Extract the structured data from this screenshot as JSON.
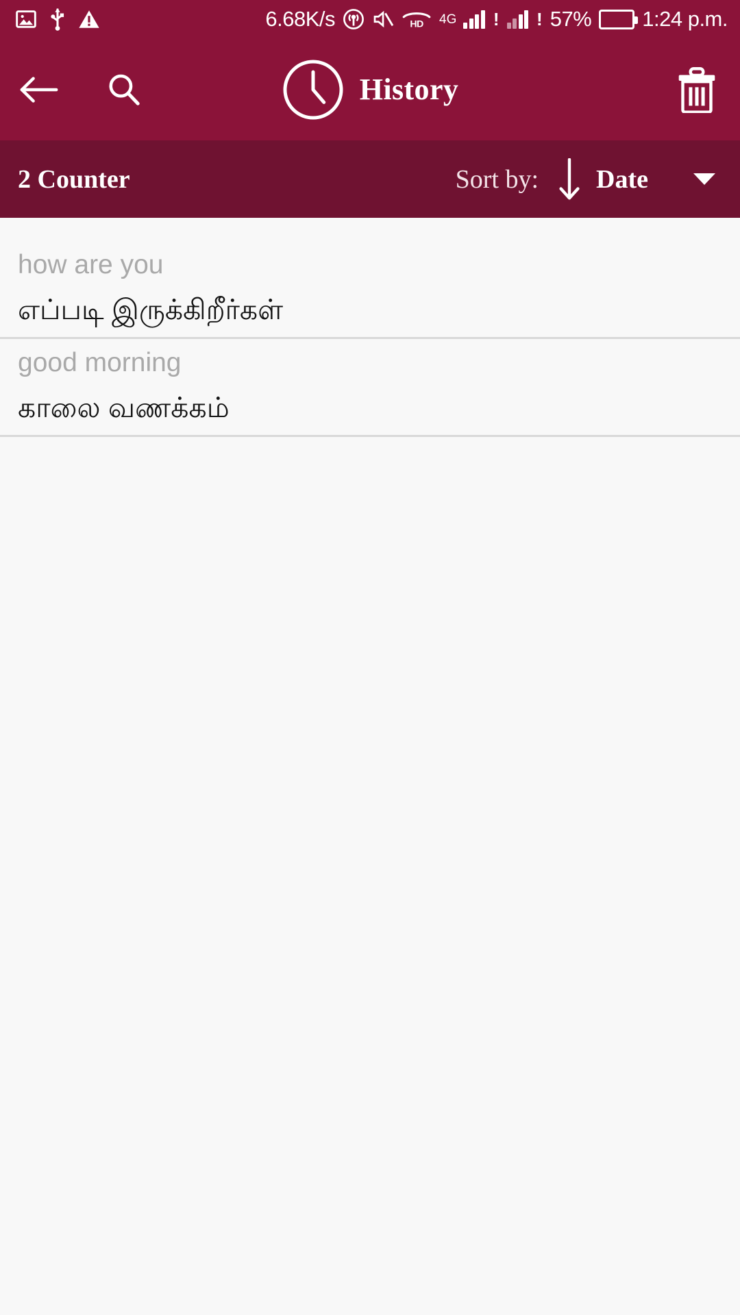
{
  "status_bar": {
    "left_icons": [
      "image-icon",
      "usb-icon",
      "warning-icon"
    ],
    "network_speed": "6.68K/s",
    "hotspot_icon": "hotspot-icon",
    "mute_icon": "mute-icon",
    "hd_label": "HD",
    "network_type": "4G",
    "battery_percent": "57%",
    "battery_level": 57,
    "clock": "1:24 p.m.",
    "background_color": "#8b1339",
    "battery_color": "#25d400"
  },
  "app_bar": {
    "back_icon": "back-arrow-icon",
    "search_icon": "search-icon",
    "clock_icon": "clock-icon",
    "title": "History",
    "delete_icon": "trash-icon",
    "background_color": "#8b1339"
  },
  "sort_bar": {
    "counter_label": "2 Counter",
    "sort_by_label": "Sort by:",
    "sort_direction_icon": "arrow-down-icon",
    "sort_value": "Date",
    "dropdown_icon": "caret-down-icon",
    "background_color": "#6f1231"
  },
  "history": {
    "items": [
      {
        "source": "how are you",
        "target": "எப்படி இருக்கிறீர்கள்"
      },
      {
        "source": "good morning",
        "target": "காலை வணக்கம்"
      }
    ]
  },
  "colors": {
    "primary": "#8b1339",
    "primary_dark": "#6f1231",
    "body_background": "#f8f8f8",
    "source_text": "#a9a9a9",
    "target_text": "#141414",
    "divider": "#d8d8d8"
  }
}
